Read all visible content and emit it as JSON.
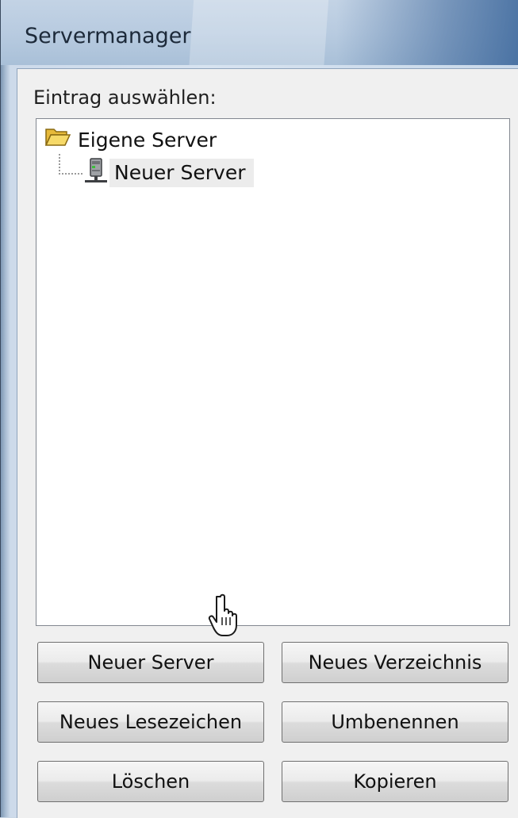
{
  "window": {
    "title": "Servermanager"
  },
  "panel": {
    "label": "Eintrag auswählen:"
  },
  "tree": {
    "root": {
      "label": "Eigene Server",
      "icon": "open-folder-icon"
    },
    "children": [
      {
        "label": "Neuer Server",
        "icon": "server-icon",
        "selected": true
      }
    ]
  },
  "buttons": {
    "new_server": "Neuer Server",
    "new_directory": "Neues Verzeichnis",
    "new_bookmark": "Neues Lesezeichen",
    "rename": "Umbenennen",
    "delete": "Löschen",
    "copy": "Kopieren"
  },
  "colors": {
    "folder": "#f2cf4a",
    "button_border": "#707070",
    "tree_border": "#828790"
  }
}
